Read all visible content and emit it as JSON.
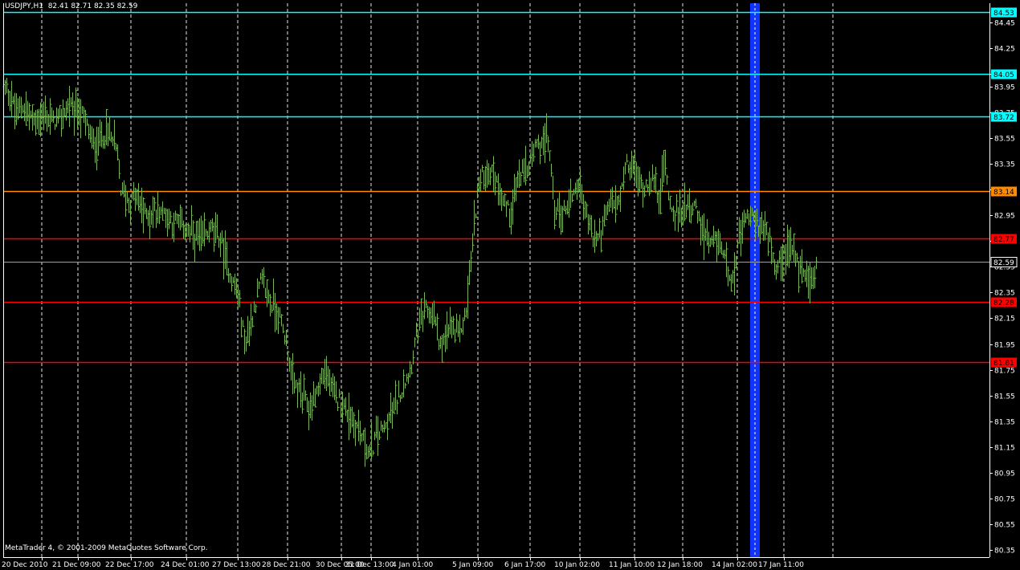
{
  "header": {
    "symbol": "USDJPY,H1",
    "ohlc": "82.41 82.71 82.35 82.59"
  },
  "copyright": "MetaTrader 4, © 2001-2009 MetaQuotes Software Corp.",
  "colors": {
    "background": "#000000",
    "axis": "#ffffff",
    "grid": "#ffffff",
    "bars": "#7bb35a",
    "cyan_level": "#00ffff",
    "orange_level": "#ff8c00",
    "red_level": "#ff0000",
    "bid_level": "#a0a0a0",
    "highlight_band": "#1133ff"
  },
  "chart_data": {
    "type": "bar",
    "title": "USDJPY,H1",
    "xlabel": "",
    "ylabel": "",
    "ylim": [
      80.3,
      84.6
    ],
    "y_ticks": [
      "84.45",
      "84.25",
      "84.05",
      "83.95",
      "83.75",
      "83.55",
      "83.35",
      "83.15",
      "82.95",
      "82.75",
      "82.55",
      "82.35",
      "82.15",
      "81.95",
      "81.75",
      "81.55",
      "81.35",
      "81.15",
      "80.95",
      "80.75",
      "80.55",
      "80.35"
    ],
    "x_tick_labels": [
      "20 Dec 2010",
      "21 Dec 09:00",
      "22 Dec 17:00",
      "24 Dec 01:00",
      "27 Dec 13:00",
      "28 Dec 21:00",
      "30 Dec 05:00",
      "31 Dec 13:00",
      "4 Jan 01:00",
      "5 Jan 09:00",
      "6 Jan 17:00",
      "10 Jan 02:00",
      "11 Jan 10:00",
      "12 Jan 18:00",
      "14 Jan 02:00",
      "17 Jan 11:00"
    ],
    "grid": true,
    "horizontal_levels": [
      {
        "value": 84.53,
        "label": "84.53",
        "color": "cyan"
      },
      {
        "value": 84.05,
        "label": "84.05",
        "color": "cyan"
      },
      {
        "value": 83.72,
        "label": "83.72",
        "color": "cyan"
      },
      {
        "value": 83.14,
        "label": "83.14",
        "color": "orange"
      },
      {
        "value": 82.77,
        "label": "82.77",
        "color": "red"
      },
      {
        "value": 82.28,
        "label": "82.28",
        "color": "red"
      },
      {
        "value": 81.81,
        "label": "81.81",
        "color": "red"
      },
      {
        "value": 82.59,
        "label": "82.59",
        "color": "bid"
      }
    ],
    "highlight": "14 Jan 02:00",
    "price_path": [
      [
        0,
        83.95
      ],
      [
        10,
        83.9
      ],
      [
        20,
        83.75
      ],
      [
        30,
        83.8
      ],
      [
        40,
        83.7
      ],
      [
        55,
        83.72
      ],
      [
        70,
        83.68
      ],
      [
        85,
        83.8
      ],
      [
        95,
        83.78
      ],
      [
        105,
        83.7
      ],
      [
        115,
        83.5
      ],
      [
        125,
        83.55
      ],
      [
        135,
        83.6
      ],
      [
        145,
        83.45
      ],
      [
        150,
        83.15
      ],
      [
        160,
        83.05
      ],
      [
        170,
        83.1
      ],
      [
        180,
        82.95
      ],
      [
        190,
        82.98
      ],
      [
        200,
        83.0
      ],
      [
        215,
        82.9
      ],
      [
        230,
        82.85
      ],
      [
        240,
        82.8
      ],
      [
        250,
        82.75
      ],
      [
        265,
        82.85
      ],
      [
        275,
        82.75
      ],
      [
        285,
        82.5
      ],
      [
        295,
        82.35
      ],
      [
        305,
        81.95
      ],
      [
        315,
        82.2
      ],
      [
        325,
        82.45
      ],
      [
        335,
        82.3
      ],
      [
        345,
        82.2
      ],
      [
        355,
        82.0
      ],
      [
        365,
        81.65
      ],
      [
        375,
        81.55
      ],
      [
        385,
        81.45
      ],
      [
        395,
        81.6
      ],
      [
        405,
        81.75
      ],
      [
        415,
        81.55
      ],
      [
        425,
        81.5
      ],
      [
        435,
        81.4
      ],
      [
        445,
        81.3
      ],
      [
        455,
        81.15
      ],
      [
        460,
        81.1
      ],
      [
        470,
        81.25
      ],
      [
        480,
        81.3
      ],
      [
        490,
        81.45
      ],
      [
        500,
        81.6
      ],
      [
        510,
        81.75
      ],
      [
        520,
        82.05
      ],
      [
        530,
        82.2
      ],
      [
        540,
        82.15
      ],
      [
        550,
        81.9
      ],
      [
        560,
        82.1
      ],
      [
        570,
        82.0
      ],
      [
        580,
        82.2
      ],
      [
        588,
        82.75
      ],
      [
        595,
        83.2
      ],
      [
        605,
        83.3
      ],
      [
        615,
        83.25
      ],
      [
        625,
        83.1
      ],
      [
        635,
        82.95
      ],
      [
        645,
        83.25
      ],
      [
        655,
        83.3
      ],
      [
        665,
        83.45
      ],
      [
        675,
        83.55
      ],
      [
        683,
        83.5
      ],
      [
        690,
        83.0
      ],
      [
        700,
        82.95
      ],
      [
        710,
        83.1
      ],
      [
        720,
        83.2
      ],
      [
        730,
        82.95
      ],
      [
        740,
        82.75
      ],
      [
        750,
        82.85
      ],
      [
        760,
        83.05
      ],
      [
        770,
        83.05
      ],
      [
        780,
        83.35
      ],
      [
        790,
        83.3
      ],
      [
        800,
        83.15
      ],
      [
        810,
        83.25
      ],
      [
        820,
        83.1
      ],
      [
        828,
        83.35
      ],
      [
        835,
        83.0
      ],
      [
        845,
        82.95
      ],
      [
        855,
        83.05
      ],
      [
        865,
        83.0
      ],
      [
        875,
        82.8
      ],
      [
        885,
        82.7
      ],
      [
        895,
        82.75
      ],
      [
        905,
        82.55
      ],
      [
        912,
        82.45
      ],
      [
        920,
        82.75
      ],
      [
        930,
        82.95
      ],
      [
        940,
        82.9
      ],
      [
        950,
        82.85
      ],
      [
        960,
        82.7
      ],
      [
        965,
        82.45
      ],
      [
        975,
        82.65
      ],
      [
        985,
        82.7
      ],
      [
        995,
        82.55
      ],
      [
        1005,
        82.5
      ],
      [
        1012,
        82.45
      ],
      [
        1017,
        82.59
      ]
    ]
  }
}
